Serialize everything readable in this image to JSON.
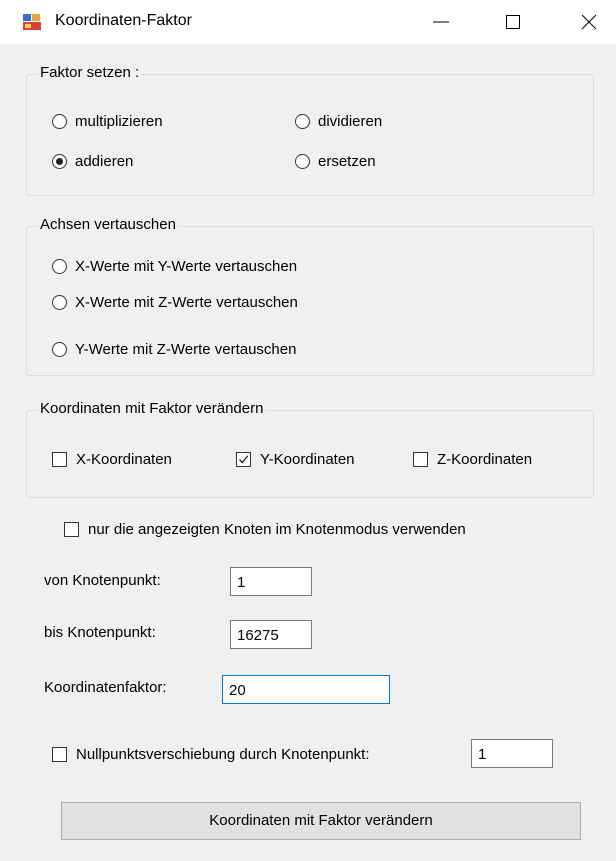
{
  "window": {
    "title": "Koordinaten-Faktor"
  },
  "faktor_setzen": {
    "legend": "Faktor setzen :",
    "options": [
      {
        "label": "multiplizieren",
        "selected": false
      },
      {
        "label": "dividieren",
        "selected": false
      },
      {
        "label": "addieren",
        "selected": true
      },
      {
        "label": "ersetzen",
        "selected": false
      }
    ]
  },
  "achsen_vertauschen": {
    "legend": "Achsen vertauschen",
    "options": [
      {
        "label": "X-Werte mit Y-Werte vertauschen",
        "selected": false
      },
      {
        "label": "X-Werte mit Z-Werte vertauschen",
        "selected": false
      },
      {
        "label": "Y-Werte mit Z-Werte vertauschen",
        "selected": false
      }
    ]
  },
  "koordinaten_faktor": {
    "legend": "Koordinaten mit Faktor verändern",
    "checks": [
      {
        "label": "X-Koordinaten",
        "checked": false
      },
      {
        "label": "Y-Koordinaten",
        "checked": true
      },
      {
        "label": "Z-Koordinaten",
        "checked": false
      }
    ]
  },
  "nur_knoten": {
    "label": "nur die angezeigten Knoten im Knotenmodus verwenden",
    "checked": false
  },
  "von_knotenpunkt": {
    "label": "von Knotenpunkt:",
    "value": "1"
  },
  "bis_knotenpunkt": {
    "label": "bis Knotenpunkt:",
    "value": "16275"
  },
  "koordinatenfaktor": {
    "label": "Koordinatenfaktor:",
    "value": "20"
  },
  "nullpunkt": {
    "label": "Nullpunktsverschiebung durch Knotenpunkt:",
    "checked": false,
    "value": "1"
  },
  "apply_button": {
    "label": "Koordinaten mit Faktor verändern"
  }
}
